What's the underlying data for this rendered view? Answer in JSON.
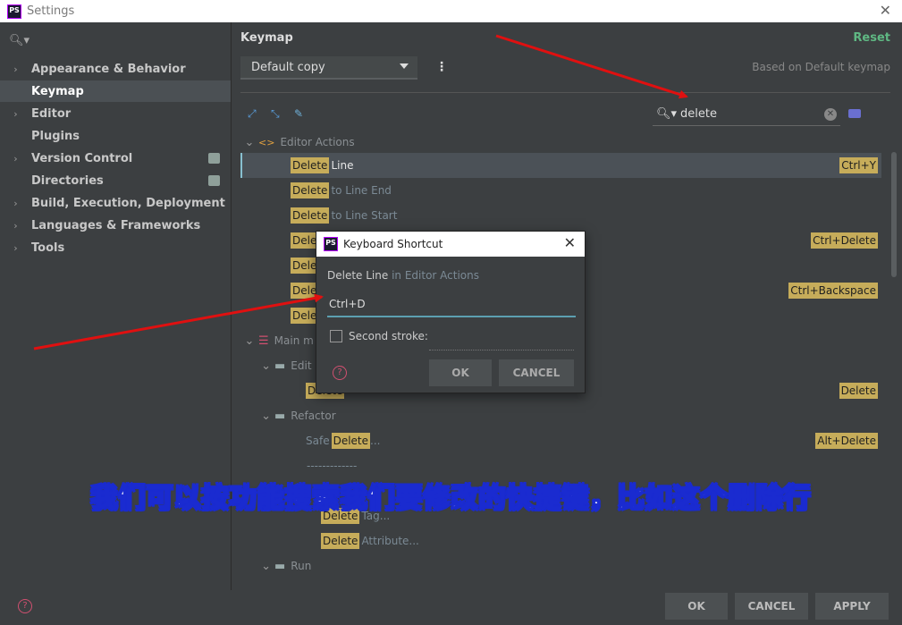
{
  "window": {
    "title": "Settings",
    "logo": "PS"
  },
  "sidebar": {
    "items": [
      {
        "label": "Appearance & Behavior",
        "has_chevron": true
      },
      {
        "label": "Keymap",
        "selected": true
      },
      {
        "label": "Editor",
        "has_chevron": true
      },
      {
        "label": "Plugins"
      },
      {
        "label": "Version Control",
        "has_chevron": true,
        "badge": true
      },
      {
        "label": "Directories",
        "badge": true
      },
      {
        "label": "Build, Execution, Deployment",
        "has_chevron": true
      },
      {
        "label": "Languages & Frameworks",
        "has_chevron": true
      },
      {
        "label": "Tools",
        "has_chevron": true
      }
    ]
  },
  "main": {
    "title": "Keymap",
    "reset_label": "Reset",
    "keymap_value": "Default copy",
    "based_on": "Based on Default keymap",
    "search_value": "delete",
    "tree": {
      "editor_actions_label": "Editor Actions",
      "main_menu_label": "Main m",
      "edit_label": "Edit",
      "refactor_label": "Refactor",
      "run_label": "Run",
      "separator": "-------------",
      "hl_word": "Delete",
      "rows": [
        {
          "rest": "Line",
          "shortcut": "Ctrl+Y"
        },
        {
          "rest": "to Line End"
        },
        {
          "rest": "to Line Start"
        },
        {
          "shortcut": "Ctrl+Delete"
        },
        {},
        {
          "shortcut": "Ctrl+Backspace"
        },
        {}
      ],
      "edit_row_shortcut": "Delete",
      "safe_prefix": "Safe",
      "safe_suffix": "...",
      "safe_shortcut": "Alt+Delete",
      "tag_suffix": "Tag...",
      "attribute_suffix": "Attribute..."
    }
  },
  "dialog": {
    "title": "Keyboard Shortcut",
    "action_name": "Delete Line",
    "action_in": "in Editor Actions",
    "shortcut_value": "Ctrl+D",
    "second_stroke_label": "Second stroke:",
    "ok_label": "OK",
    "cancel_label": "CANCEL"
  },
  "footer": {
    "ok_label": "OK",
    "cancel_label": "CANCEL",
    "apply_label": "APPLY"
  },
  "caption": "我们可以按功能搜索我们要修改的快捷键，比如这个删除行",
  "colors": {
    "highlight": "#c6ac5a",
    "arrow": "#e01010",
    "caption_stroke": "#1a2bd0",
    "reset": "#5fb883"
  }
}
